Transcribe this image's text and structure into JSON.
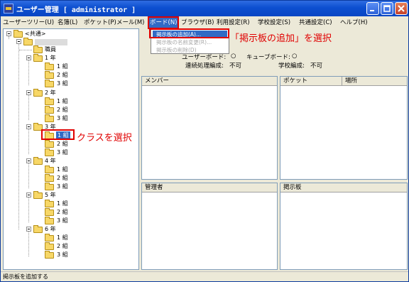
{
  "window": {
    "title": "ユーザー管理 [ administrator ]"
  },
  "menubar": {
    "items": [
      "ユーザーツリー(U)",
      "名簿(L)",
      "ポケット(P)",
      "メール(M)",
      "ボード(N)",
      "ブラウザ(B)",
      "利用設定(R)",
      "学校設定(S)",
      "共通設定(C)",
      "ヘルプ(H)"
    ],
    "active_index": 4
  },
  "board_menu": {
    "items": [
      {
        "label": "掲示板の追加(A)...",
        "state": "selected"
      },
      {
        "label": "掲示板の名前変更(R)...",
        "state": "disabled"
      },
      {
        "label": "掲示板の削除(D)",
        "state": "disabled"
      }
    ]
  },
  "annotations": {
    "menu_note": "「掲示板の追加」を選択",
    "class_note": "クラスを選択",
    "color": "#e00000"
  },
  "tree": {
    "root": "<共通>",
    "staff": "職員",
    "grades": [
      {
        "label": "1 年",
        "classes": [
          "1 組",
          "2 組",
          "3 組"
        ]
      },
      {
        "label": "2 年",
        "classes": [
          "1 組",
          "2 組",
          "3 組"
        ]
      },
      {
        "label": "3 年",
        "classes": [
          "1 組",
          "2 組",
          "3 組"
        ]
      },
      {
        "label": "4 年",
        "classes": [
          "1 組",
          "2 組",
          "3 組"
        ]
      },
      {
        "label": "5 年",
        "classes": [
          "1 組",
          "2 組",
          "3 組"
        ]
      },
      {
        "label": "6 年",
        "classes": [
          "1 組",
          "2 組",
          "3 組"
        ]
      }
    ],
    "selected": "3 年 / 1 組"
  },
  "info": {
    "user_board_label": "ユーザーボード:",
    "user_board_value": "○",
    "cube_board_label": "キューブボード:",
    "cube_board_value": "○",
    "serial_label": "連続処理編成:",
    "serial_value": "不可",
    "school_label": "学校編成:",
    "school_value": "不可"
  },
  "panels": {
    "members": "メンバー",
    "pocket": "ポケット",
    "location": "場所",
    "admins": "管理者",
    "boards": "掲示板"
  },
  "status": {
    "text": "掲示板を追加する"
  }
}
